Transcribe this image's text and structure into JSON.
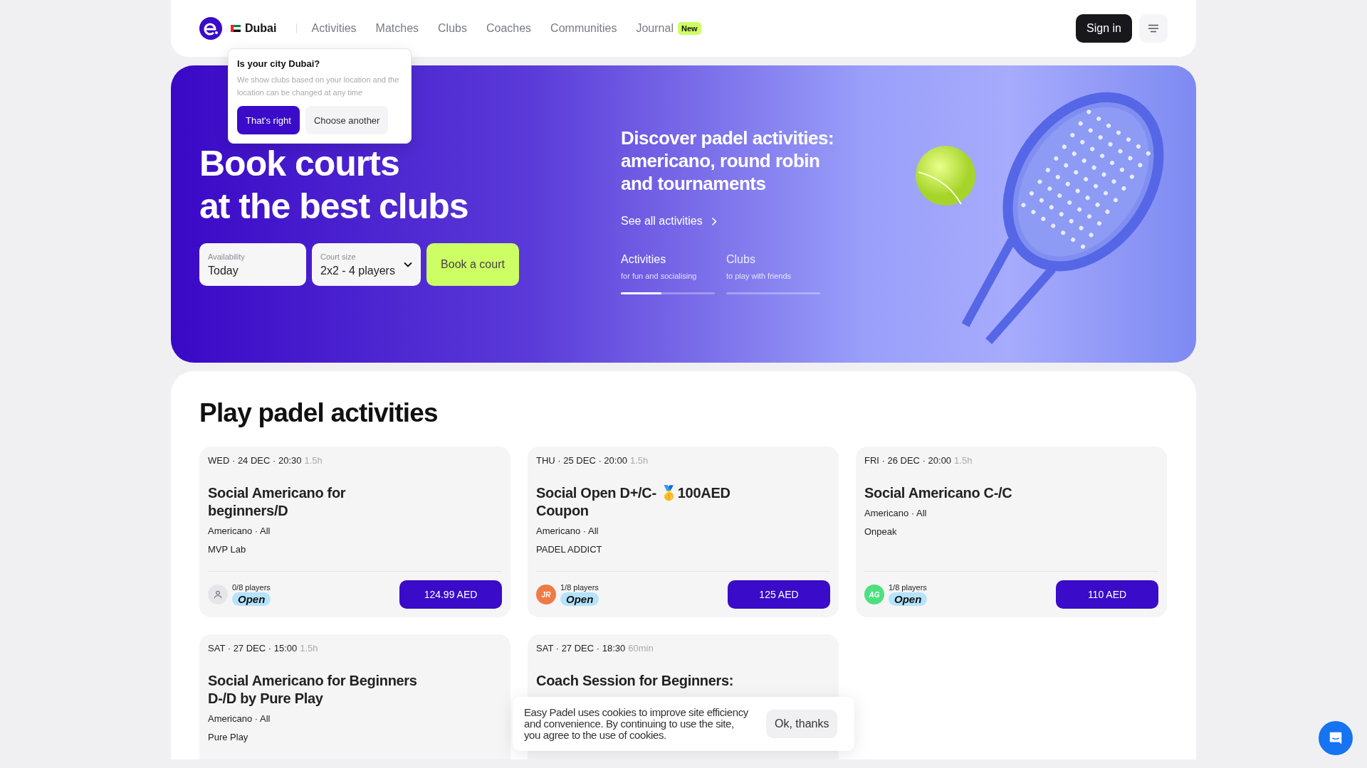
{
  "header": {
    "city": "Dubai",
    "nav": [
      {
        "label": "Activities"
      },
      {
        "label": "Matches"
      },
      {
        "label": "Clubs"
      },
      {
        "label": "Coaches"
      },
      {
        "label": "Communities"
      },
      {
        "label": "Journal",
        "badge": "New"
      }
    ],
    "sign_in": "Sign in"
  },
  "city_prompt": {
    "title": "Is your city Dubai?",
    "text": "We show clubs based on your location and the location can be changed at any time",
    "confirm": "That's right",
    "other": "Choose another"
  },
  "hero": {
    "title": "Book courts\nat the best clubs",
    "fields": [
      {
        "kind": "text",
        "label": "Availability",
        "value": "Today"
      },
      {
        "kind": "select",
        "label": "Court size",
        "value": "2x2 - 4 players"
      }
    ],
    "book": "Book a court",
    "subtitle": "Discover padel activities: americano, round robin and tournaments",
    "link": "See all activities",
    "tabs": [
      {
        "title": "Activities",
        "caption": "for fun and socialising",
        "selected": true,
        "level": 0.43
      },
      {
        "title": "Clubs",
        "caption": "to play with friends",
        "selected": false,
        "level": 0
      }
    ]
  },
  "activities": {
    "title": "Play padel activities",
    "cards": [
      {
        "date": "WED · 24 DEC · 20:30",
        "duration": "1.5h",
        "title": "Social Americano for beginners/D",
        "meta": "Americano · All",
        "club": "MVP Lab",
        "avatar": {
          "kind": "icon",
          "color": "#e6e6ea"
        },
        "players": "0/8 players",
        "status": "Open",
        "price": "124.99 AED"
      },
      {
        "date": "THU · 25 DEC · 20:00",
        "duration": "1.5h",
        "title": "Social Open D+/C- 🥇100AED Coupon",
        "meta": "Americano · All",
        "club": "PADEL ADDICT",
        "avatar": {
          "kind": "initials",
          "initials": "JR",
          "color": "#ef7a45"
        },
        "players": "1/8 players",
        "status": "Open",
        "price": "125 AED"
      },
      {
        "date": "FRI · 26 DEC · 20:00",
        "duration": "1.5h",
        "title": "Social Americano C-/C",
        "meta": "Americano · All",
        "club": "Onpeak",
        "avatar": {
          "kind": "initials",
          "initials": "AG",
          "color": "#4ee07f"
        },
        "players": "1/8 players",
        "status": "Open",
        "price": "110 AED"
      },
      {
        "date": "SAT · 27 DEC · 15:00",
        "duration": "1.5h",
        "title": "Social Americano for Beginners D-/D by Pure Play",
        "meta": "Americano · All",
        "club": "Pure Play"
      },
      {
        "date": "SAT · 27 DEC · 18:30",
        "duration": "60min",
        "title": "Coach Session for Beginners:"
      }
    ]
  },
  "cookie": {
    "text": "Easy Padel uses cookies to improve site efficiency and convenience. By continuing to use the site, you agree to the use of cookies.",
    "button": "Ok, thanks"
  }
}
